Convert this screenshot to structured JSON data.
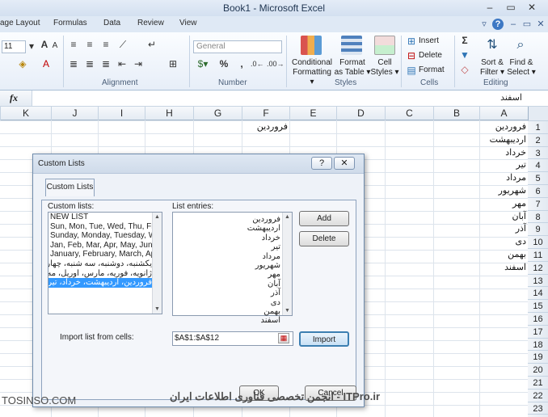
{
  "window": {
    "title": "Book1 - Microsoft Excel",
    "min": "–",
    "restore": "▭",
    "close": "✕"
  },
  "ribbon_tabs": [
    "age Layout",
    "Formulas",
    "Data",
    "Review",
    "View"
  ],
  "ribbon": {
    "font_size": "11",
    "number_format": "General",
    "groups": {
      "alignment": "Alignment",
      "number": "Number",
      "styles": "Styles",
      "cells": "Cells",
      "editing": "Editing"
    },
    "styles": {
      "conditional_formatting": [
        "Conditional",
        "Formatting ▾"
      ],
      "format_as_table": [
        "Format",
        "as Table ▾"
      ],
      "cell_styles": [
        "Cell",
        "Styles ▾"
      ]
    },
    "cells": {
      "insert": "Insert",
      "delete": "Delete",
      "format": "Format"
    },
    "editing": {
      "sort_filter": [
        "Sort &",
        "Filter ▾"
      ],
      "find_select": [
        "Find &",
        "Select ▾"
      ],
      "sum": "Σ",
      "percent": "%",
      "comma": ","
    }
  },
  "formula_bar": {
    "fx": "fx",
    "content": "اسفند"
  },
  "columns": [
    "K",
    "J",
    "I",
    "H",
    "G",
    "F",
    "E",
    "D",
    "C",
    "B",
    "A"
  ],
  "rows": [
    "1",
    "2",
    "3",
    "4",
    "5",
    "6",
    "7",
    "8",
    "9",
    "10",
    "11",
    "12",
    "13",
    "14",
    "15",
    "16",
    "17",
    "18",
    "19",
    "20",
    "21",
    "22",
    "23",
    "24"
  ],
  "col_a": [
    "فروردین",
    "اردیبهشت",
    "خرداد",
    "تیر",
    "مرداد",
    "شهریور",
    "مهر",
    "آبان",
    "آذر",
    "دی",
    "بهمن",
    "اسفند"
  ],
  "f1": "فروردین",
  "dialog": {
    "title": "Custom Lists",
    "help": "?",
    "close": "✕",
    "tab": "Custom Lists",
    "custom_lists_label": "Custom lists:",
    "custom_lists": [
      "NEW LIST",
      "Sun, Mon, Tue, Wed, Thu, Fri, S",
      "Sunday, Monday, Tuesday, Wec",
      "Jan, Feb, Mar, Apr, May, Jun, J",
      "January, February, March, April",
      "یکشنبه، دوشنبه، سه شنبه، چهار",
      "ژانویه، فوریه، مارس، آوریل، مه، ژوا",
      "فروردین، اردیبهشت، خرداد، تیر، م"
    ],
    "list_entries_label": "List entries:",
    "list_entries": [
      "فروردین",
      "اردیبهشت",
      "خرداد",
      "تیر",
      "مرداد",
      "شهریور",
      "مهر",
      "آبان",
      "آذر",
      "دی",
      "بهمن",
      "اسفند"
    ],
    "add": "Add",
    "delete": "Delete",
    "import_label": "Import list from cells:",
    "import_ref": "$A$1:$A$12",
    "import": "Import",
    "ok": "OK",
    "cancel": "Cancel"
  },
  "watermark": {
    "left": "TOSINSO.COM",
    "center": "انجمن تخصصی فناوری اطلاعات ایران - ITPro.ir"
  }
}
